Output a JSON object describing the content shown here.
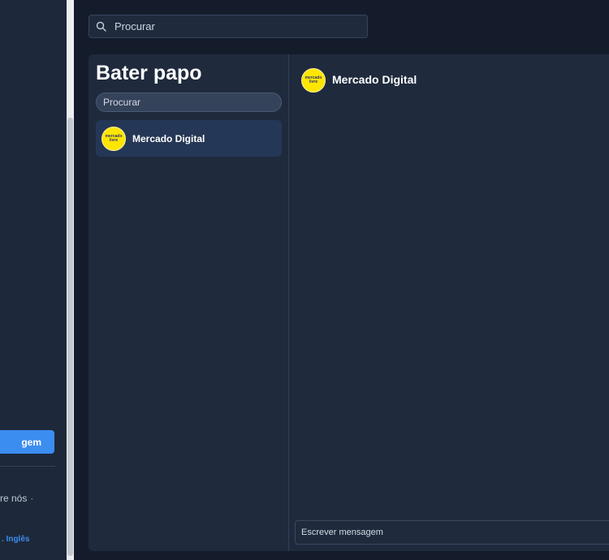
{
  "sidebar": {
    "button_label": "gem",
    "about_label": "re nós",
    "about_separator": "·",
    "language_label": ". Inglês"
  },
  "top_search": {
    "placeholder": "Procurar",
    "icon": "search-icon"
  },
  "chat": {
    "title": "Bater papo",
    "search_placeholder": "Procurar",
    "conversations": [
      {
        "name": "Mercado Digital",
        "avatar_text": "mercado livre"
      }
    ],
    "active": {
      "name": "Mercado Digital",
      "avatar_text": "mercado livre"
    },
    "message_placeholder": "Escrever mensagem"
  },
  "colors": {
    "accent": "#3b8df0",
    "avatar_yellow": "#ffe600",
    "panel": "#1f2a3d",
    "background": "#141c2c"
  }
}
